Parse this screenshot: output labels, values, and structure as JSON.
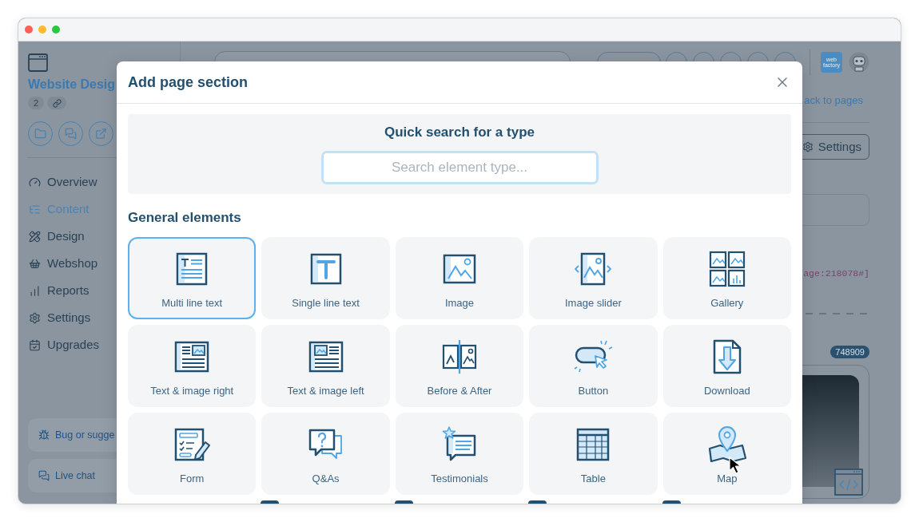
{
  "sidebar": {
    "title": "Website Desig",
    "page_count": "2",
    "nav": [
      {
        "label": "Overview",
        "selected": false
      },
      {
        "label": "Content",
        "selected": true
      },
      {
        "label": "Design",
        "selected": false
      },
      {
        "label": "Webshop",
        "selected": false
      },
      {
        "label": "Reports",
        "selected": false
      },
      {
        "label": "Settings",
        "selected": false
      },
      {
        "label": "Upgrades",
        "selected": false
      }
    ],
    "help_links": [
      "Bug or sugge",
      "Live chat"
    ]
  },
  "top_bar": {
    "logo_text": "web factory"
  },
  "right_panel": {
    "back_link": "ack to pages",
    "settings_button": "Settings",
    "code_snippet": "age:218078#]",
    "item_id": "748909"
  },
  "modal": {
    "title": "Add page section",
    "search_heading": "Quick search for a type",
    "search": {
      "placeholder": "Search element type..."
    },
    "section_title": "General elements",
    "elements": [
      {
        "label": "Multi line text",
        "selected": true
      },
      {
        "label": "Single line text",
        "selected": false
      },
      {
        "label": "Image",
        "selected": false
      },
      {
        "label": "Image slider",
        "selected": false
      },
      {
        "label": "Gallery",
        "selected": false
      },
      {
        "label": "Text & image right",
        "selected": false
      },
      {
        "label": "Text & image left",
        "selected": false
      },
      {
        "label": "Before & After",
        "selected": false
      },
      {
        "label": "Button",
        "selected": false
      },
      {
        "label": "Download",
        "selected": false
      },
      {
        "label": "Form",
        "selected": false
      },
      {
        "label": "Q&As",
        "selected": false
      },
      {
        "label": "Testimonials",
        "selected": false
      },
      {
        "label": "Table",
        "selected": false
      },
      {
        "label": "Map",
        "selected": false
      }
    ]
  }
}
